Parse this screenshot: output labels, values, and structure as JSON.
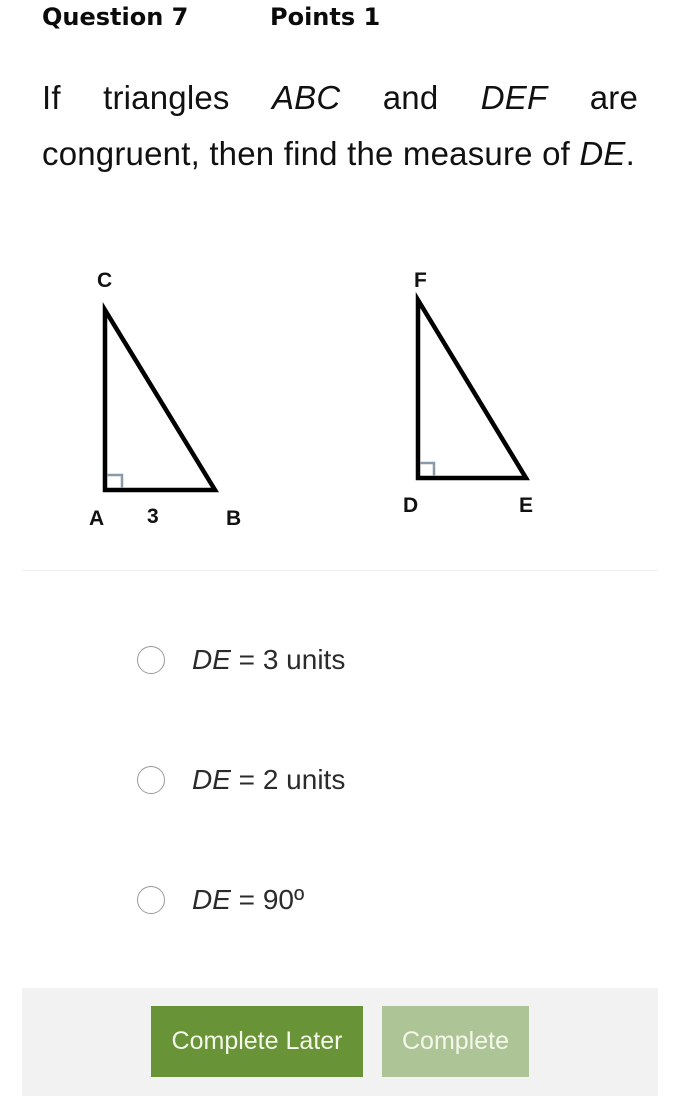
{
  "header": {
    "question_label": "Question 7",
    "points_label": "Points 1"
  },
  "question": {
    "part1": "If triangles ",
    "abc": "ABC",
    "part2": " and ",
    "def": "DEF",
    "part3": " are congruent, then find the measure of ",
    "de": "DE",
    "part4": "."
  },
  "figure": {
    "triangle1": {
      "vertices": [
        "A",
        "B",
        "C"
      ],
      "side_label": "3",
      "right_angle_at": "A"
    },
    "triangle2": {
      "vertices": [
        "D",
        "E",
        "F"
      ],
      "right_angle_at": "D"
    }
  },
  "options": [
    {
      "var": "DE",
      "rest": " = 3 units",
      "selected": false
    },
    {
      "var": "DE",
      "rest": " = 2 units",
      "selected": false
    },
    {
      "var": "DE",
      "rest": " = 90º",
      "selected": false
    }
  ],
  "footer": {
    "complete_later_label": "Complete Later",
    "complete_label": "Complete",
    "complete_later_color": "#689437",
    "complete_color": "#adc596"
  }
}
